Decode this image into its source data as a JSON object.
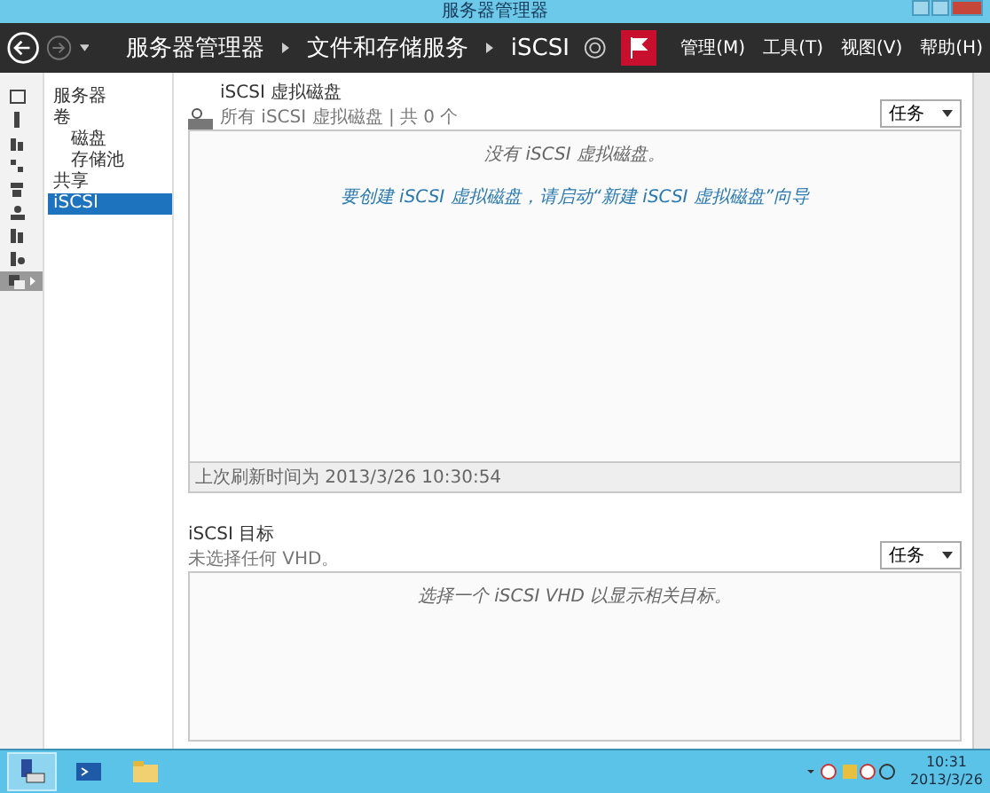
{
  "window": {
    "title": "服务器管理器"
  },
  "header": {
    "breadcrumb": [
      "服务器管理器",
      "文件和存储服务",
      "iSCSI"
    ],
    "menu": [
      "管理(M)",
      "工具(T)",
      "视图(V)",
      "帮助(H)"
    ]
  },
  "side_icons": [
    {
      "selected": false
    },
    {
      "selected": false
    },
    {
      "selected": false
    },
    {
      "selected": false
    },
    {
      "selected": false
    },
    {
      "selected": false
    },
    {
      "selected": false
    },
    {
      "selected": false
    },
    {
      "selected": true
    }
  ],
  "nav": [
    {
      "label": "服务器",
      "selected": false
    },
    {
      "label": "卷",
      "selected": false,
      "children": [
        {
          "label": "磁盘",
          "selected": false
        },
        {
          "label": "存储池",
          "selected": false
        }
      ]
    },
    {
      "label": "共享",
      "selected": false
    },
    {
      "label": "iSCSI",
      "selected": true
    }
  ],
  "disks_panel": {
    "title": "iSCSI 虚拟磁盘",
    "subtitle": "所有 iSCSI 虚拟磁盘 | 共 0 个",
    "tasks": "任务",
    "empty": "没有 iSCSI 虚拟磁盘。",
    "link": "要创建 iSCSI 虚拟磁盘，请启动“新建 iSCSI 虚拟磁盘”向导",
    "footer": "上次刷新时间为 2013/3/26 10:30:54"
  },
  "targets_panel": {
    "title": "iSCSI 目标",
    "subtitle": "未选择任何 VHD。",
    "tasks": "任务",
    "empty": "选择一个 iSCSI VHD 以显示相关目标。"
  },
  "taskbar": {
    "apps": [
      {
        "selected": true
      },
      {
        "selected": false
      },
      {
        "selected": false
      }
    ],
    "time": "10:31",
    "date": "2013/3/26"
  }
}
